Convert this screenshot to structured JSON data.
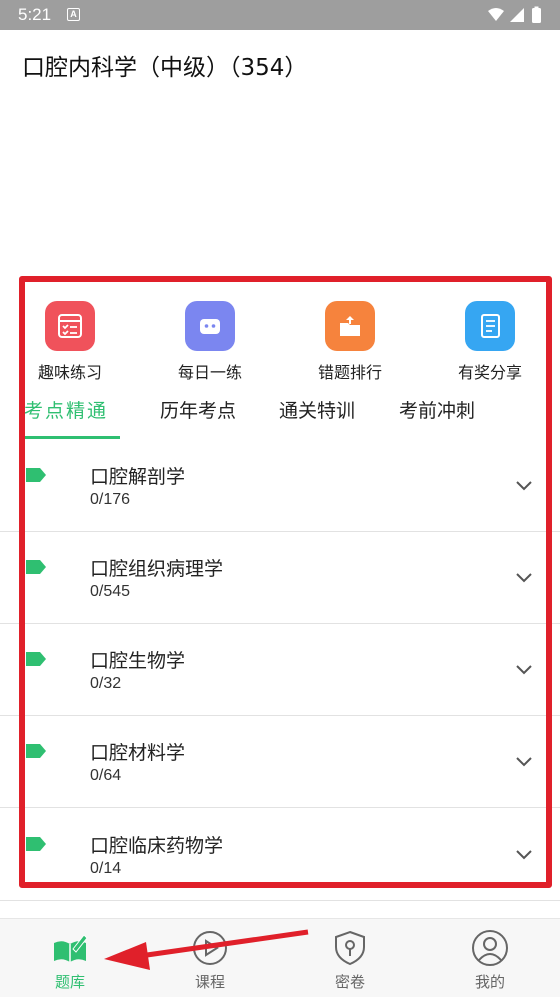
{
  "status_bar": {
    "time": "5:21",
    "badge": "A"
  },
  "page": {
    "title": "口腔内科学（中级）（354）"
  },
  "quick_actions": [
    {
      "label": "趣味练习",
      "icon": "checklist-icon",
      "color": "#f0525b"
    },
    {
      "label": "每日一练",
      "icon": "robot-icon",
      "color": "#7b86f0"
    },
    {
      "label": "错题排行",
      "icon": "folder-upload-icon",
      "color": "#f6833d"
    },
    {
      "label": "有奖分享",
      "icon": "notebook-icon",
      "color": "#36a6f2"
    }
  ],
  "tabs": [
    {
      "label": "考点精通",
      "active": true
    },
    {
      "label": "历年考点",
      "active": false
    },
    {
      "label": "通关特训",
      "active": false
    },
    {
      "label": "考前冲刺",
      "active": false
    }
  ],
  "chapters": [
    {
      "name": "口腔解剖学",
      "progress": "0/176"
    },
    {
      "name": "口腔组织病理学",
      "progress": "0/545"
    },
    {
      "name": "口腔生物学",
      "progress": "0/32"
    },
    {
      "name": "口腔材料学",
      "progress": "0/64"
    },
    {
      "name": "口腔临床药物学",
      "progress": "0/14"
    }
  ],
  "bottom_nav": [
    {
      "label": "题库",
      "icon": "book-pen-icon",
      "active": true
    },
    {
      "label": "课程",
      "icon": "play-circle-icon",
      "active": false
    },
    {
      "label": "密卷",
      "icon": "shield-key-icon",
      "active": false
    },
    {
      "label": "我的",
      "icon": "user-icon",
      "active": false
    }
  ],
  "colors": {
    "accent": "#2fbf71",
    "annotation": "#e0202a",
    "status_bar": "#9e9e9e"
  }
}
